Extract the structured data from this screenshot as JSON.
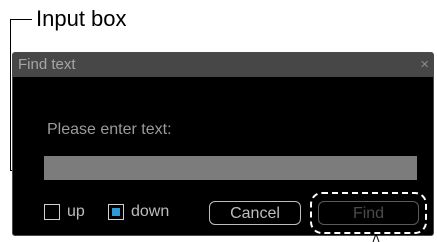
{
  "callout": {
    "label": "Input box"
  },
  "dialog": {
    "title": "Find text",
    "close_glyph": "×",
    "prompt": "Please enter text:",
    "input": {
      "value": "",
      "placeholder": ""
    },
    "direction": {
      "up_label": "up",
      "down_label": "down",
      "selected": "down"
    },
    "buttons": {
      "cancel_label": "Cancel",
      "find_label": "Find",
      "find_enabled": false
    }
  },
  "colors": {
    "dialog_bg": "#000000",
    "titlebar_bg": "#474747",
    "input_bg": "#7c7c7c",
    "checkbox_accent": "#2e9bd6"
  },
  "icons": {
    "close": "close-icon",
    "checkbox": "checkbox-icon"
  }
}
